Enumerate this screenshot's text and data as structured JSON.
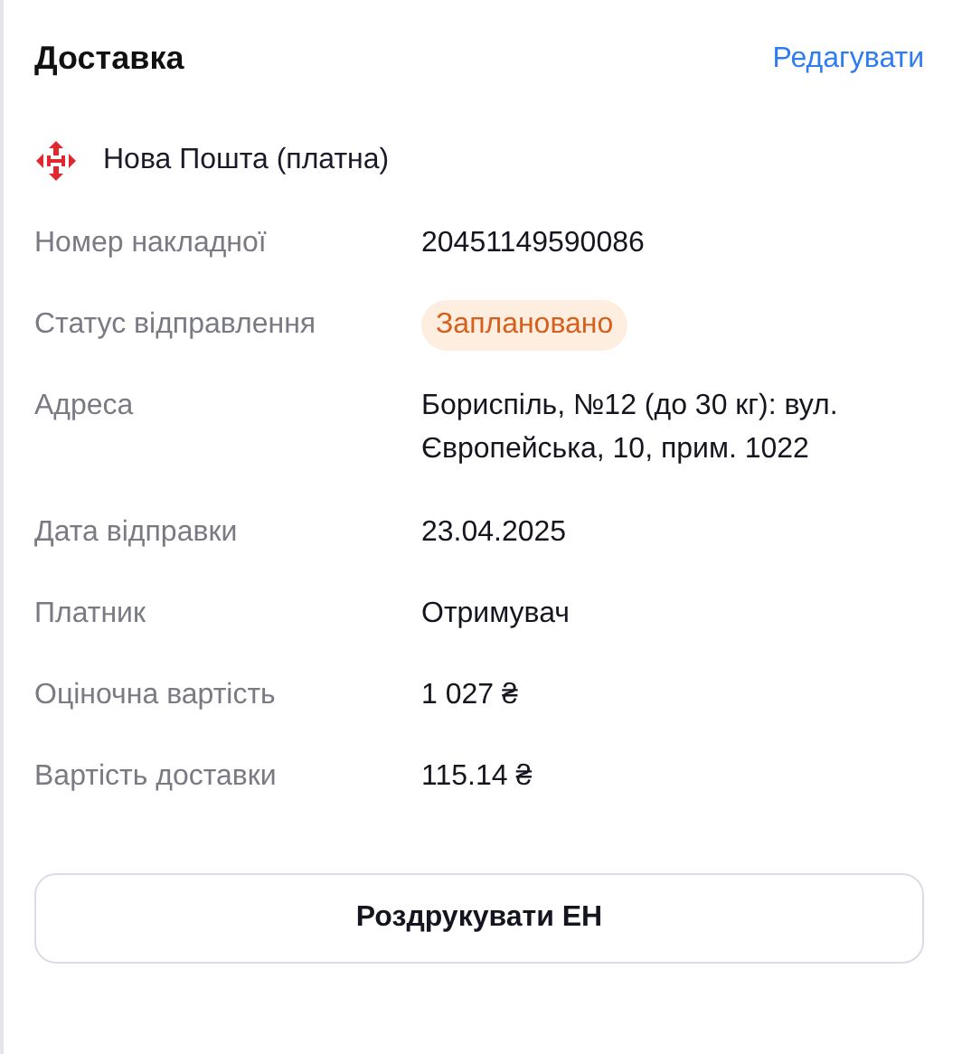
{
  "title": "Доставка",
  "edit_link": "Редагувати",
  "carrier": {
    "name": "Нова Пошта (платна)"
  },
  "fields": [
    {
      "label": "Номер накладної",
      "value": "20451149590086",
      "kind": "text"
    },
    {
      "label": "Статус відправлення",
      "value": "Заплановано",
      "kind": "badge"
    },
    {
      "label": "Адреса",
      "value": "Бориспіль, №12 (до 30 кг): вул. Європейська, 10, прим. 1022",
      "kind": "text"
    },
    {
      "label": "Дата відправки",
      "value": "23.04.2025",
      "kind": "text"
    },
    {
      "label": "Платник",
      "value": "Отримувач",
      "kind": "text"
    },
    {
      "label": "Оціночна вартість",
      "value": "1 027 ₴",
      "kind": "text"
    },
    {
      "label": "Вартість доставки",
      "value": "115.14 ₴",
      "kind": "text"
    }
  ],
  "print_button": "Роздрукувати ЕН"
}
